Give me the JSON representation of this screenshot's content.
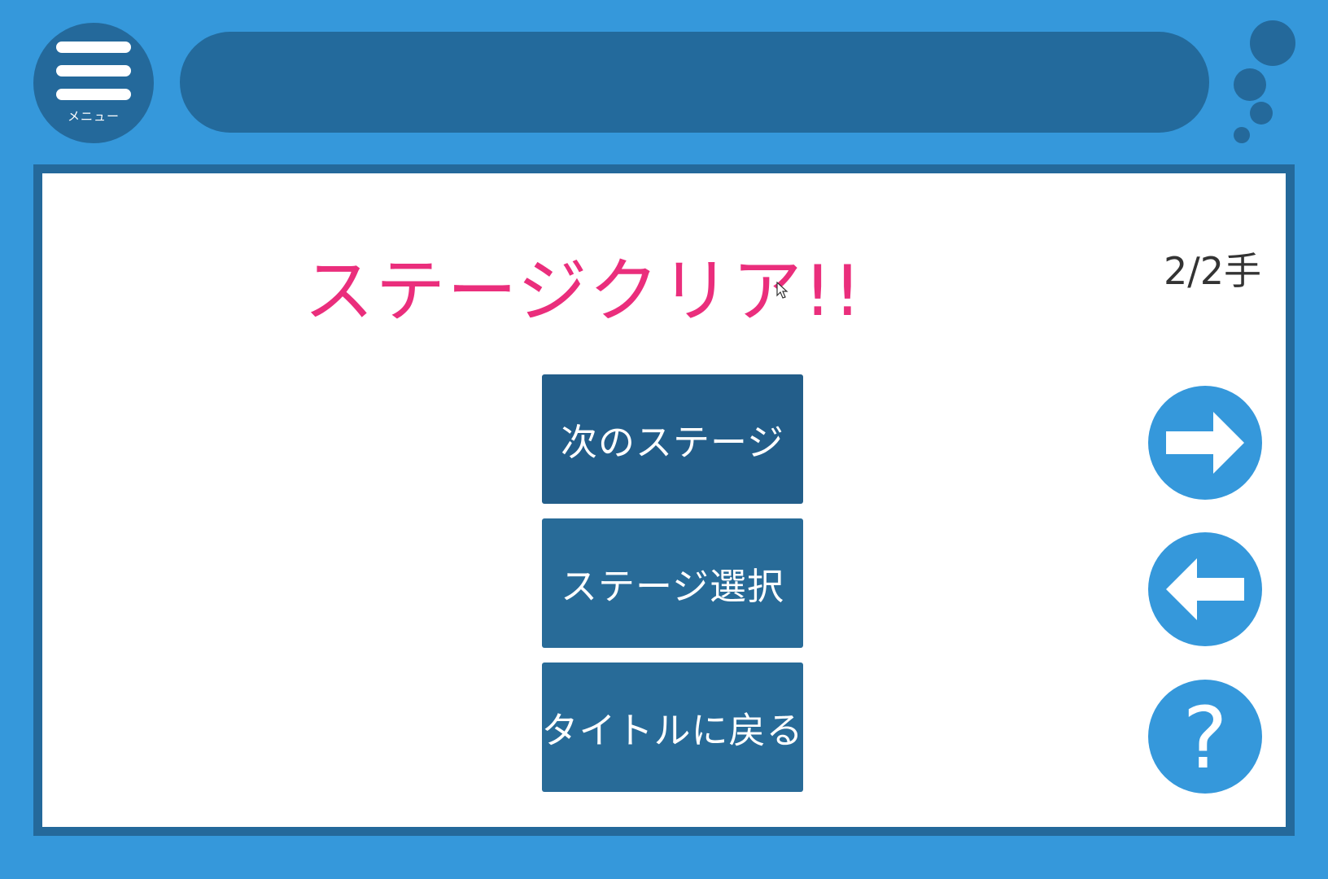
{
  "menu": {
    "label": "メニュー"
  },
  "result": {
    "title": "ステージクリア!!",
    "moves": "2/2手"
  },
  "options": [
    {
      "label": "次のステージ"
    },
    {
      "label": "ステージ選択"
    },
    {
      "label": "タイトルに戻る"
    }
  ],
  "side_buttons": {
    "next_icon": "arrow-right-icon",
    "prev_icon": "arrow-left-icon",
    "help_glyph": "?"
  },
  "colors": {
    "background": "#3598db",
    "dark_accent": "#24699b",
    "title": "#ea2e7c",
    "button": "#286b98",
    "button_active": "#235e8a"
  }
}
